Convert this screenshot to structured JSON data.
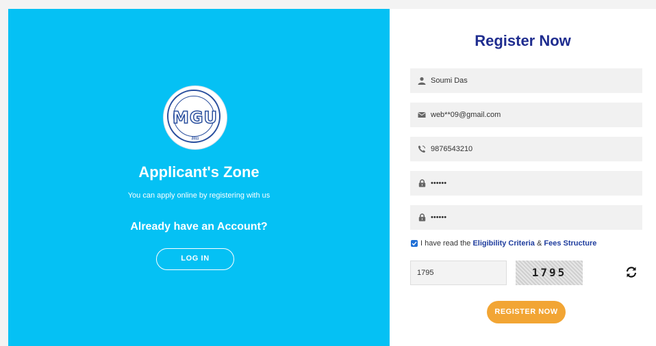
{
  "left_panel": {
    "logo_text": "MGU",
    "logo_caption": "MAHATMA GANDHI UNIVERSITY",
    "logo_year": "2011",
    "title": "Applicant's Zone",
    "subtitle": "You can apply online by registering with us",
    "already_text": "Already have an Account?",
    "login_label": "LOG IN",
    "bg_color": "#05c1f4"
  },
  "register": {
    "title": "Register Now",
    "fields": [
      {
        "icon": "user-icon",
        "value": "Soumi Das"
      },
      {
        "icon": "envelope-icon",
        "value": "web**09@gmail.com"
      },
      {
        "icon": "phone-icon",
        "value": "9876543210"
      },
      {
        "icon": "lock-icon",
        "value": "••••••"
      },
      {
        "icon": "lock-icon",
        "value": "••••••"
      }
    ],
    "agree": {
      "checked": true,
      "prefix": "I have read the",
      "link1": "Eligibility Criteria",
      "mid": "&",
      "link2": "Fees Structure"
    },
    "captcha_input": "1795",
    "captcha_code": "1795",
    "register_label": "REGISTER NOW",
    "accent_color": "#f2a534",
    "title_color": "#1f2d8f"
  }
}
